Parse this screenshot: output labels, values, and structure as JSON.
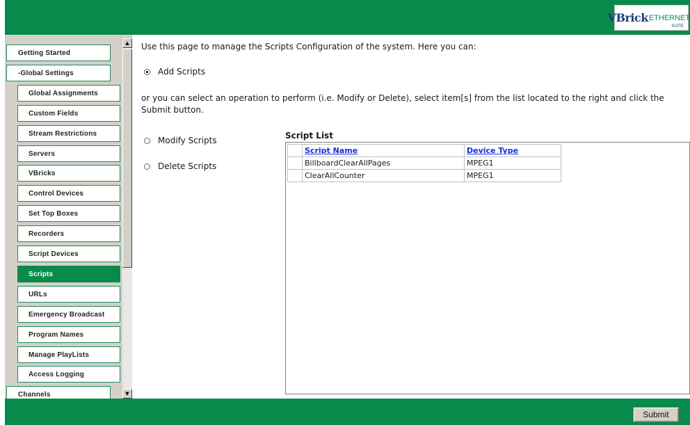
{
  "logo": {
    "brand": "VBrick",
    "product": "ETHERNETV",
    "suite": "SUITE"
  },
  "sidebar": {
    "items": [
      {
        "label": "Getting Started",
        "level": 0
      },
      {
        "label": "-Global Settings",
        "level": 0
      },
      {
        "label": "Global Assignments",
        "level": 1
      },
      {
        "label": "Custom Fields",
        "level": 1
      },
      {
        "label": "Stream Restrictions",
        "level": 1
      },
      {
        "label": "Servers",
        "level": 1
      },
      {
        "label": "VBricks",
        "level": 1
      },
      {
        "label": "Control Devices",
        "level": 1
      },
      {
        "label": "Set Top Boxes",
        "level": 1
      },
      {
        "label": "Recorders",
        "level": 1
      },
      {
        "label": "Script Devices",
        "level": 1
      },
      {
        "label": "Scripts",
        "level": 1,
        "active": true
      },
      {
        "label": "URLs",
        "level": 1
      },
      {
        "label": "Emergency Broadcast",
        "level": 1
      },
      {
        "label": "Program Names",
        "level": 1
      },
      {
        "label": "Manage PlayLists",
        "level": 1
      },
      {
        "label": "Access Logging",
        "level": 1
      },
      {
        "label": "Channels",
        "level": 0
      }
    ],
    "active_color": "#078a4a"
  },
  "main": {
    "intro": "Use this page to manage the Scripts Configuration of the system. Here you can:",
    "add_option": "Add Scripts",
    "instructions": "or you can select an operation to perform (i.e. Modify or Delete), select item[s] from the list located to the right and click the Submit button.",
    "modify_option": "Modify Scripts",
    "delete_option": "Delete Scripts",
    "list_title": "Script List",
    "columns": [
      "Script Name",
      "Device Type"
    ],
    "rows": [
      {
        "name": "BillboardClearAllPages",
        "device": "MPEG1"
      },
      {
        "name": "ClearAllCounter",
        "device": "MPEG1"
      }
    ]
  },
  "footer": {
    "submit_label": "Submit"
  },
  "colors": {
    "header_green": "#088a4a",
    "link_blue": "#1a2fd0"
  }
}
